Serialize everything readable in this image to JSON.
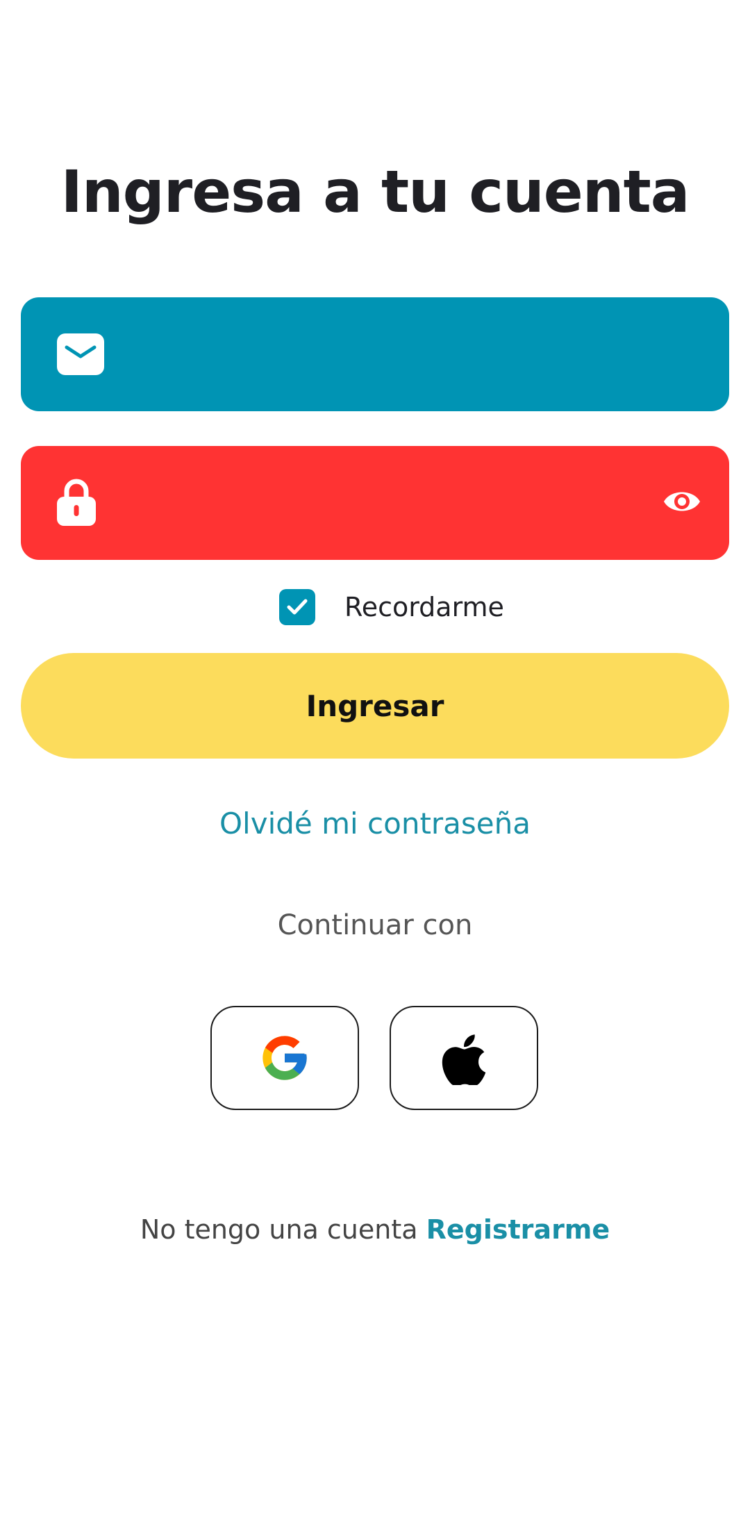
{
  "header": {
    "title": "Ingresa a tu cuenta"
  },
  "email_field": {
    "value": "",
    "icon": "mail-icon",
    "color": "#0094b4"
  },
  "password_field": {
    "value": "",
    "icon": "lock-icon",
    "toggle_icon": "eye-icon",
    "color": "#ff3333"
  },
  "remember": {
    "label": "Recordarme",
    "checked": true
  },
  "login_button": {
    "label": "Ingresar",
    "color": "#fcdc5c"
  },
  "forgot_link": "Olvidé mi contraseña",
  "continue_label": "Continuar con",
  "social": [
    {
      "provider": "google",
      "icon": "google-icon"
    },
    {
      "provider": "apple",
      "icon": "apple-icon"
    }
  ],
  "signup": {
    "prompt": "No tengo una cuenta",
    "link": "Registrarme"
  },
  "colors": {
    "accent": "#1a8fa6",
    "text": "#1f1f24"
  }
}
